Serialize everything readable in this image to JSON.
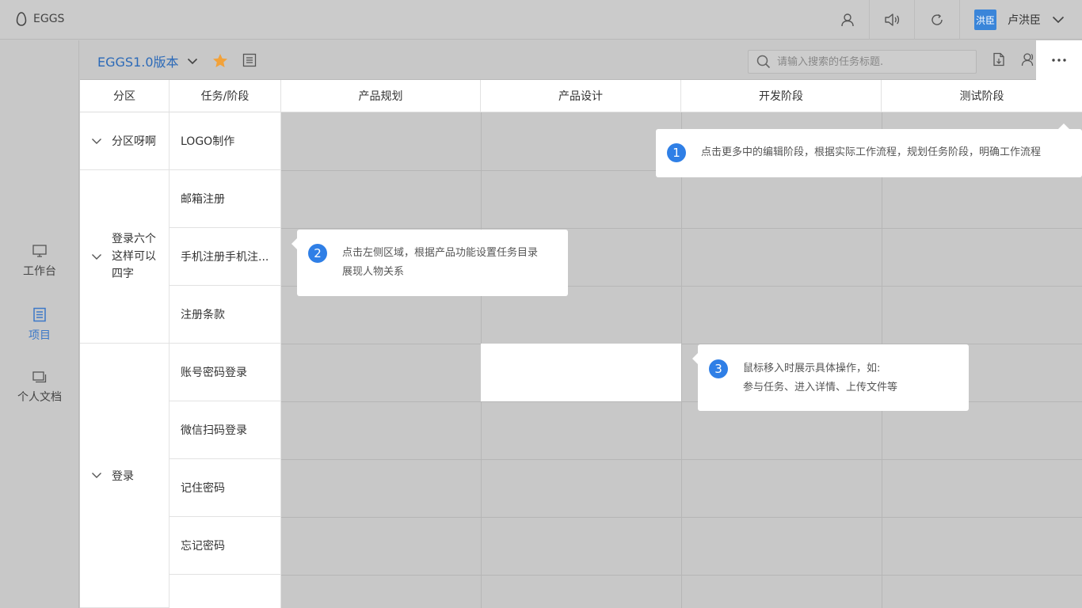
{
  "app": {
    "logo_text": "EGGS"
  },
  "user": {
    "avatar_text": "洪臣",
    "name": "卢洪臣"
  },
  "sidebar": {
    "items": [
      {
        "label": "工作台",
        "icon": "monitor-icon",
        "active": false
      },
      {
        "label": "项目",
        "icon": "clipboard-icon",
        "active": true
      },
      {
        "label": "个人文档",
        "icon": "documents-icon",
        "active": false
      }
    ]
  },
  "project": {
    "title": "EGGS1.0版本"
  },
  "search": {
    "placeholder": "请输入搜索的任务标题."
  },
  "table": {
    "headers": {
      "section": "分区",
      "task": "任务/阶段",
      "stages": [
        "产品规划",
        "产品设计",
        "开发阶段",
        "测试阶段"
      ]
    },
    "sections": [
      {
        "name": "分区呀啊",
        "tasks": [
          "LOGO制作"
        ]
      },
      {
        "name": "登录六个这样可以四字",
        "tasks": [
          "邮箱注册",
          "手机注册手机注...",
          "注册条款"
        ]
      },
      {
        "name": "登录",
        "tasks": [
          "账号密码登录",
          "微信扫码登录",
          "记住密码",
          "忘记密码"
        ]
      }
    ]
  },
  "tips": [
    {
      "number": "1",
      "text": "点击更多中的编辑阶段，根据实际工作流程，规划任务阶段，明确工作流程"
    },
    {
      "number": "2",
      "line1": "点击左侧区域，根据产品功能设置任务目录",
      "line2": "展现人物关系"
    },
    {
      "number": "3",
      "line1": "鼠标移入时展示具体操作，如:",
      "line2": "参与任务、进入详情、上传文件等"
    }
  ],
  "colors": {
    "accent": "#2f7fe6",
    "title": "#2c6ab8",
    "star": "#f2a23a",
    "overlay": "#c8c8c8"
  }
}
